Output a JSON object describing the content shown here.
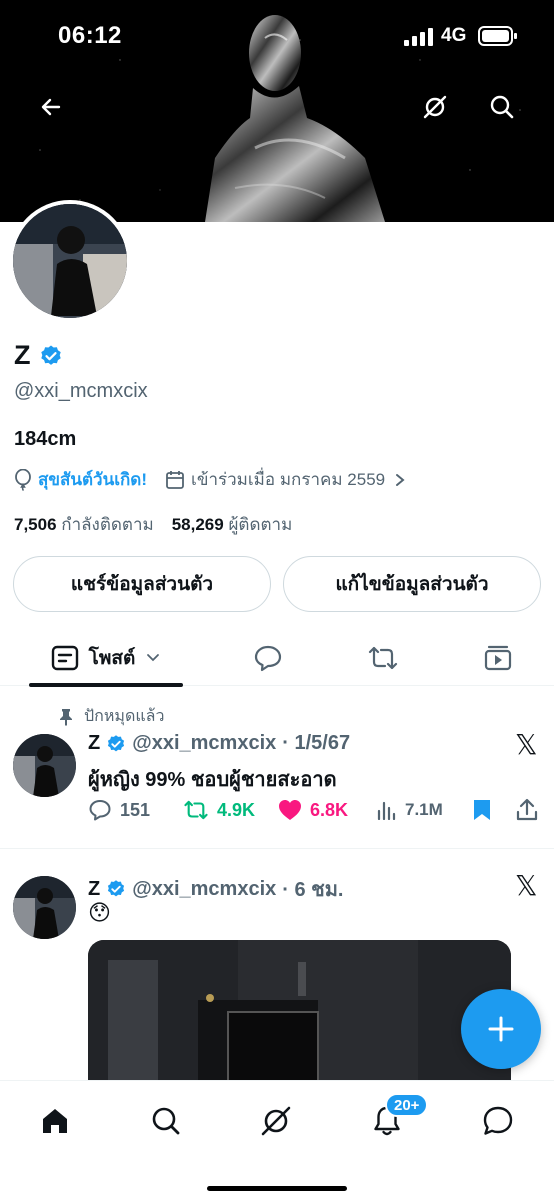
{
  "status_bar": {
    "time": "06:12",
    "network": "4G"
  },
  "header": {
    "back_icon": "arrow-left-icon",
    "grok_icon": "grok-icon",
    "search_icon": "search-icon"
  },
  "profile": {
    "display_name": "Z",
    "verified": true,
    "handle": "@xxi_mcmxcix",
    "bio": "184cm",
    "birthday": "สุขสันต์วันเกิด!",
    "joined": "เข้าร่วมเมื่อ มกราคม 2559",
    "following_count": "7,506",
    "following_label": "กำลังติดตาม",
    "followers_count": "58,269",
    "followers_label": "ผู้ติดตาม"
  },
  "buttons": {
    "share": "แชร์ข้อมูลส่วนตัว",
    "edit": "แก้ไขข้อมูลส่วนตัว"
  },
  "tabs": {
    "posts_label": "โพสต์",
    "active": "posts"
  },
  "posts": [
    {
      "pinned_label": "ปักหมุดแล้ว",
      "name": "Z",
      "handle": "@xxi_mcmxcix",
      "time": "· 1/5/67",
      "text": "ผู้หญิง 99% ชอบผู้ชายสะอาด",
      "replies": "151",
      "reposts": "4.9K",
      "likes": "6.8K",
      "views": "7.1M"
    },
    {
      "name": "Z",
      "handle": "@xxi_mcmxcix",
      "time": "· 6 ชม.",
      "text": "😯"
    }
  ],
  "bottom_nav": {
    "notification_badge": "20+"
  },
  "colors": {
    "accent": "#1d9bf0",
    "repost": "#00ba7c",
    "like": "#f91880",
    "muted": "#536471",
    "text": "#0f1419"
  }
}
